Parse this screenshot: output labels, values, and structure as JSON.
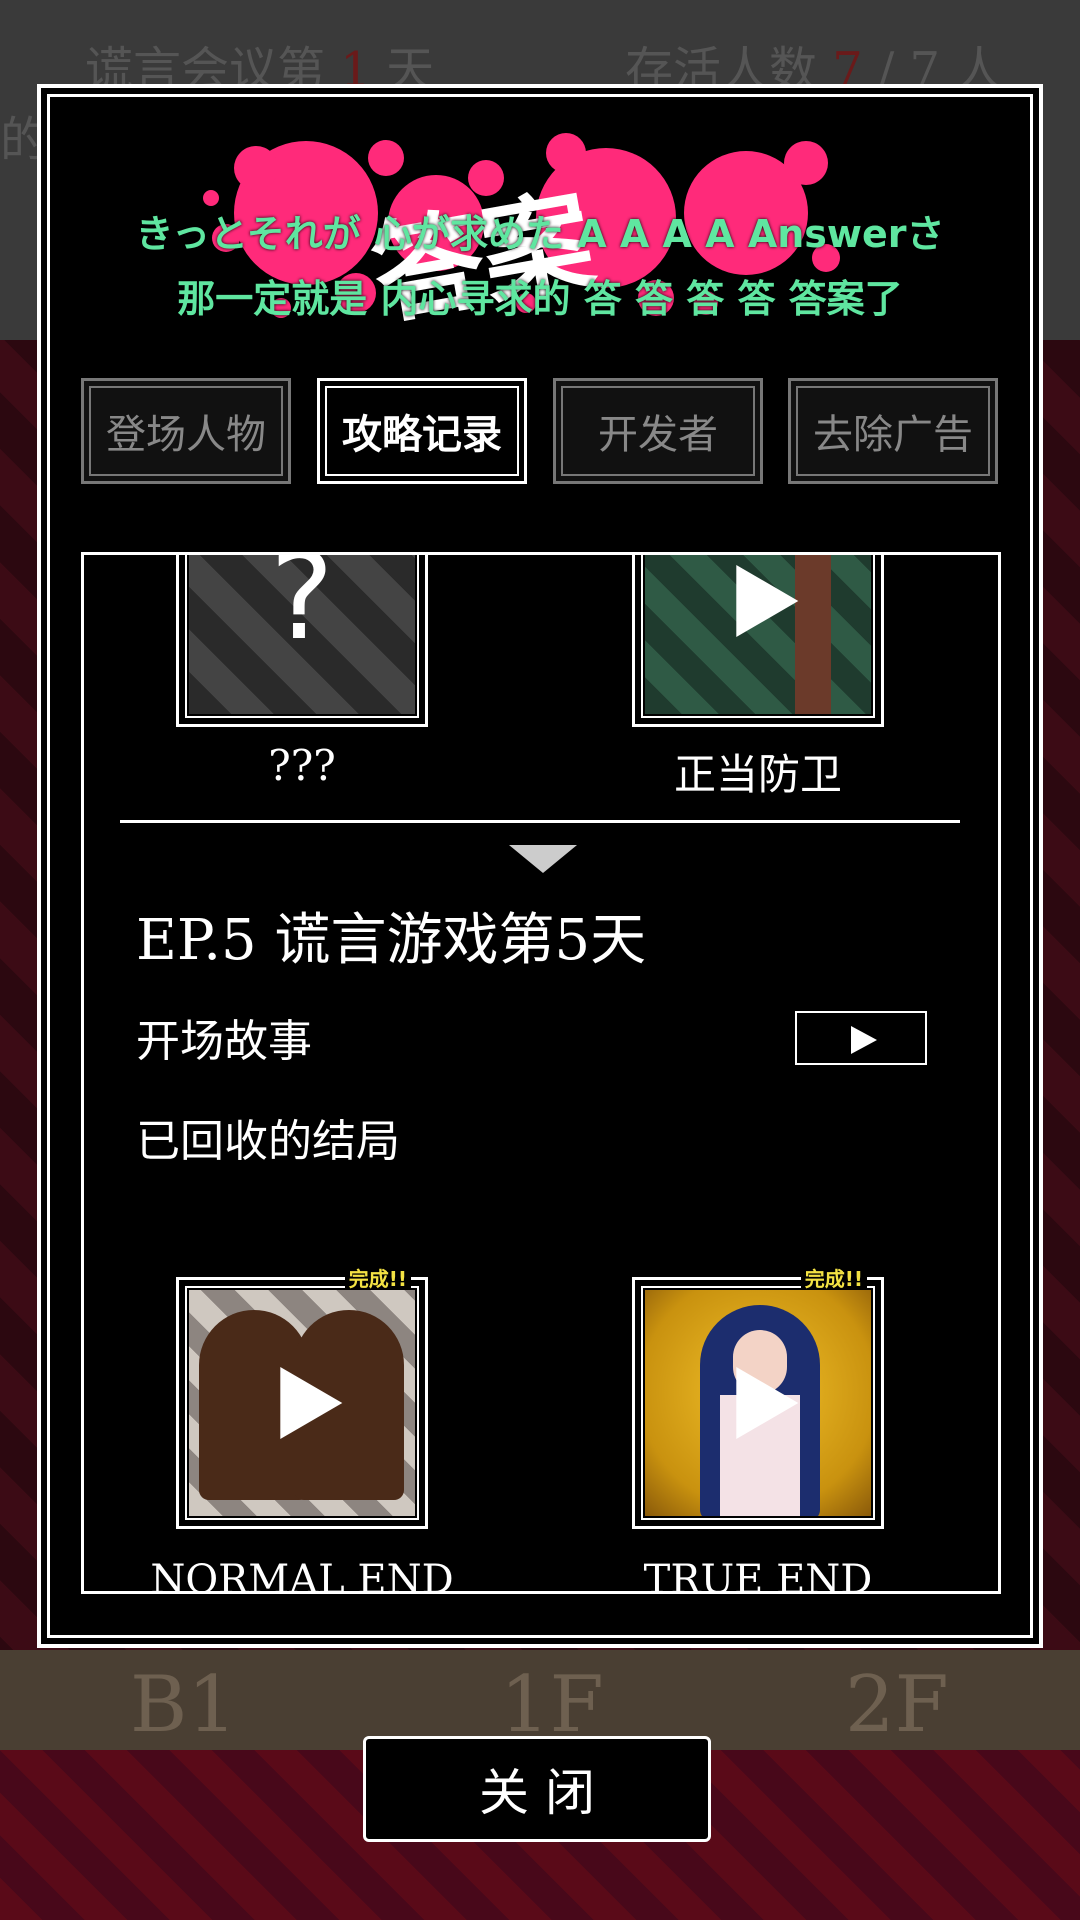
{
  "background": {
    "header_left_prefix": "谎言会议第",
    "day_number": "1",
    "header_left_suffix": "天",
    "header_right_prefix": "存活人数",
    "alive_count": "7",
    "alive_separator": "/",
    "alive_total": "7",
    "alive_unit": "人",
    "side_char": "的",
    "floors": [
      "B1",
      "1F",
      "2F"
    ]
  },
  "banner": {
    "logo_text": "答案",
    "subtitle_jp": "きっとそれが 心が求めた A A A A Answerさ",
    "subtitle_cn": "那一定就是 内心寻求的 答 答 答 答 答案了"
  },
  "tabs": [
    {
      "label": "登场人物",
      "active": false
    },
    {
      "label": "攻略记录",
      "active": true
    },
    {
      "label": "开发者",
      "active": false
    },
    {
      "label": "去除广告",
      "active": false
    }
  ],
  "previous_endings": [
    {
      "label": "???",
      "state": "unknown"
    },
    {
      "label": "正当防卫",
      "state": "playable"
    }
  ],
  "episode": {
    "title": "EP.5  谎言游戏第5天",
    "opening_label": "开场故事",
    "endings_label": "已回收的结局",
    "endings": [
      {
        "label": "NORMAL END",
        "badge": "完成!!"
      },
      {
        "label": "TRUE END",
        "badge": "完成!!"
      }
    ]
  },
  "close_button": {
    "label": "关 闭"
  },
  "colors": {
    "subtitle": "#5fe6a0",
    "splat": "#ff2a7a",
    "badge": "#f3e243",
    "background_wine": "#3c0b15"
  }
}
